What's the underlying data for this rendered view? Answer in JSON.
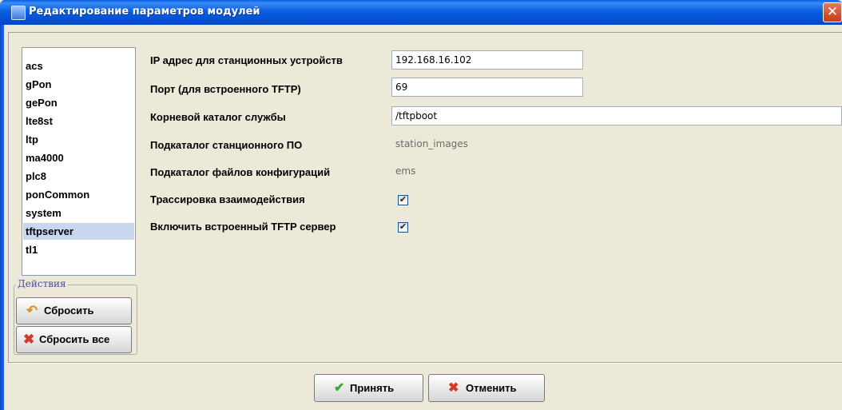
{
  "window": {
    "title": "Редактирование параметров модулей",
    "close_glyph": "✕"
  },
  "modules": {
    "items": [
      "acs",
      "gPon",
      "gePon",
      "lte8st",
      "ltp",
      "ma4000",
      "plc8",
      "ponCommon",
      "system",
      "tftpserver",
      "tl1"
    ],
    "selected": "tftpserver"
  },
  "actions": {
    "legend": "Действия",
    "reset_label": "Сбросить",
    "reset_all_label": "Сбросить все"
  },
  "params": {
    "ip": {
      "label": "IP адрес для станционных устройств",
      "value": "192.168.16.102"
    },
    "port": {
      "label": "Порт (для встроенного TFTP)",
      "value": "69"
    },
    "root": {
      "label": "Корневой каталог службы",
      "value": "/tftpboot"
    },
    "station_dir": {
      "label": "Подкаталог станционного ПО",
      "value": "station_images"
    },
    "config_dir": {
      "label": "Подкаталог файлов конфигураций",
      "value": "ems"
    },
    "trace": {
      "label": "Трассировка взаимодействия",
      "checked": true
    },
    "tftp_enable": {
      "label": "Включить встроенный TFTP сервер",
      "checked": true
    }
  },
  "footer": {
    "accept_label": "Принять",
    "cancel_label": "Отменить"
  },
  "icons": {
    "window": "window-icon",
    "reset": "undo-arrow-icon",
    "reset_all": "red-x-icon",
    "accept": "green-check-icon",
    "cancel": "red-x-icon"
  },
  "colors": {
    "title_bar": "#0a5fe3",
    "selection": "#c8d7f0",
    "accept_icon": "#3aa83a",
    "cancel_icon": "#d23a2a"
  }
}
